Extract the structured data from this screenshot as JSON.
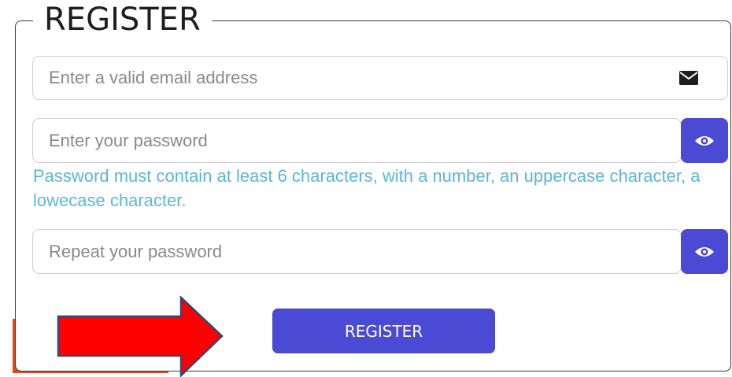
{
  "form": {
    "title": "REGISTER",
    "email": {
      "placeholder": "Enter a valid email address",
      "value": ""
    },
    "password": {
      "placeholder": "Enter your password",
      "value": ""
    },
    "password_hint": "Password must contain at least 6 characters, with a number, an uppercase character, a lowecase character.",
    "repeat_password": {
      "placeholder": "Repeat your password",
      "value": ""
    },
    "submit_label": "REGISTER"
  },
  "icons": {
    "email": "envelope-icon",
    "toggle_password": "eye-icon",
    "annotation": "arrow-right-icon"
  },
  "colors": {
    "accent": "#4a4ad4",
    "hint": "#5bb7d6",
    "arrow_fill": "#ff0000",
    "arrow_stroke": "#2e4a7a",
    "strip": "#e8451f"
  }
}
